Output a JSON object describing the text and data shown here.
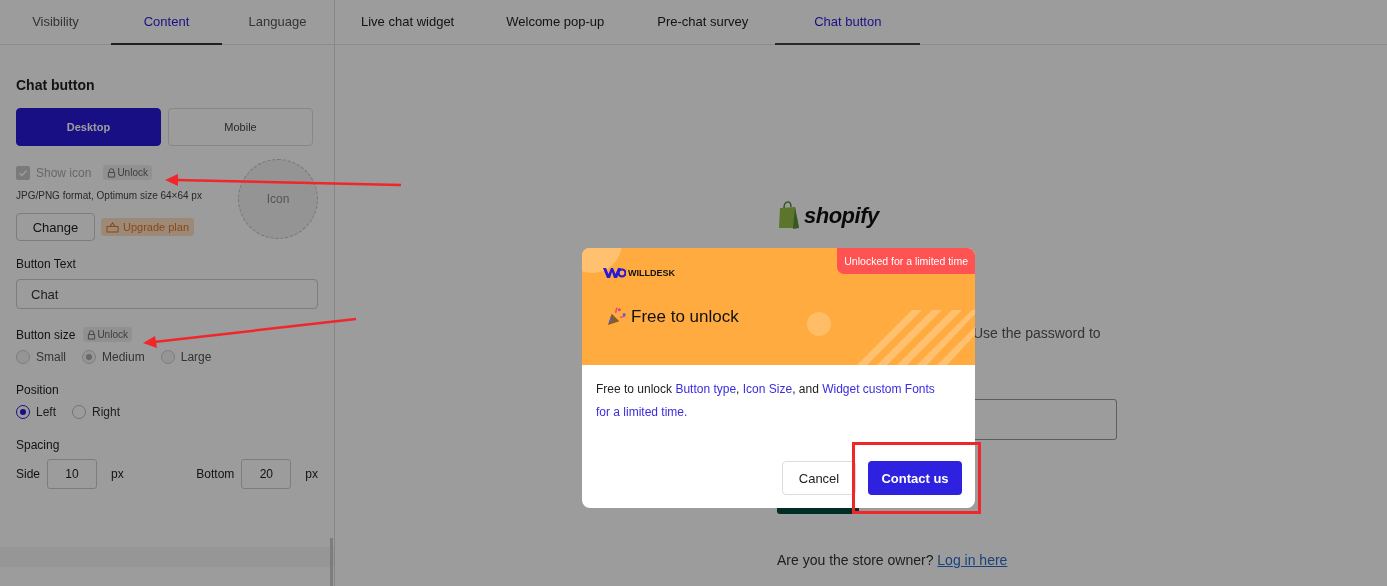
{
  "settings_tabs": [
    {
      "label": "Visibility",
      "selected": false
    },
    {
      "label": "Content",
      "selected": true
    },
    {
      "label": "Language",
      "selected": false
    }
  ],
  "preview_tabs": [
    {
      "label": "Live chat widget",
      "selected": false
    },
    {
      "label": "Welcome pop-up",
      "selected": false
    },
    {
      "label": "Pre-chat survey",
      "selected": false
    },
    {
      "label": "Chat button",
      "selected": true
    }
  ],
  "section_title": "Chat button",
  "device_toggle": [
    {
      "label": "Desktop",
      "selected": true
    },
    {
      "label": "Mobile",
      "selected": false
    }
  ],
  "show_icon": {
    "label": "Show icon",
    "checked": true,
    "disabled": true,
    "badge": "Unlock"
  },
  "icon_hint": "JPG/PNG format, Optimum size 64×64 px",
  "change_button": "Change",
  "upgrade_badge": "Upgrade plan",
  "icon_preview": "Icon",
  "button_text": {
    "label": "Button Text",
    "value": "Chat"
  },
  "button_size": {
    "label": "Button size",
    "badge": "Unlock",
    "disabled": true,
    "options": [
      {
        "label": "Small",
        "selected": false
      },
      {
        "label": "Medium",
        "selected": true
      },
      {
        "label": "Large",
        "selected": false
      }
    ]
  },
  "position": {
    "label": "Position",
    "disabled": false,
    "options": [
      {
        "label": "Left",
        "selected": true
      },
      {
        "label": "Right",
        "selected": false
      }
    ]
  },
  "spacing": {
    "label": "Spacing",
    "fields": [
      {
        "label": "Side",
        "value": "10",
        "unit": "px"
      },
      {
        "label": "Bottom",
        "value": "20",
        "unit": "px"
      }
    ]
  },
  "store": {
    "logo": "shopify",
    "message": "Use the password to",
    "footer": "Are you the store owner?",
    "login_link": "Log in here"
  },
  "dialog": {
    "badge": "Unlocked for a limited time",
    "brand": "WILLDESK",
    "title": "Free to unlock",
    "body": [
      {
        "text": "Free to unlock ",
        "link": false
      },
      {
        "text": "Button type",
        "link": true
      },
      {
        "text": ", ",
        "link": false
      },
      {
        "text": "Icon Size",
        "link": true
      },
      {
        "text": ", and ",
        "link": false
      },
      {
        "text": "Widget custom Fonts",
        "link": true
      },
      {
        "text": "for a limited time.",
        "link": true
      }
    ],
    "buttons": [
      {
        "label": "Cancel",
        "kind": "secondary"
      },
      {
        "label": "Contact us",
        "kind": "primary"
      }
    ]
  }
}
